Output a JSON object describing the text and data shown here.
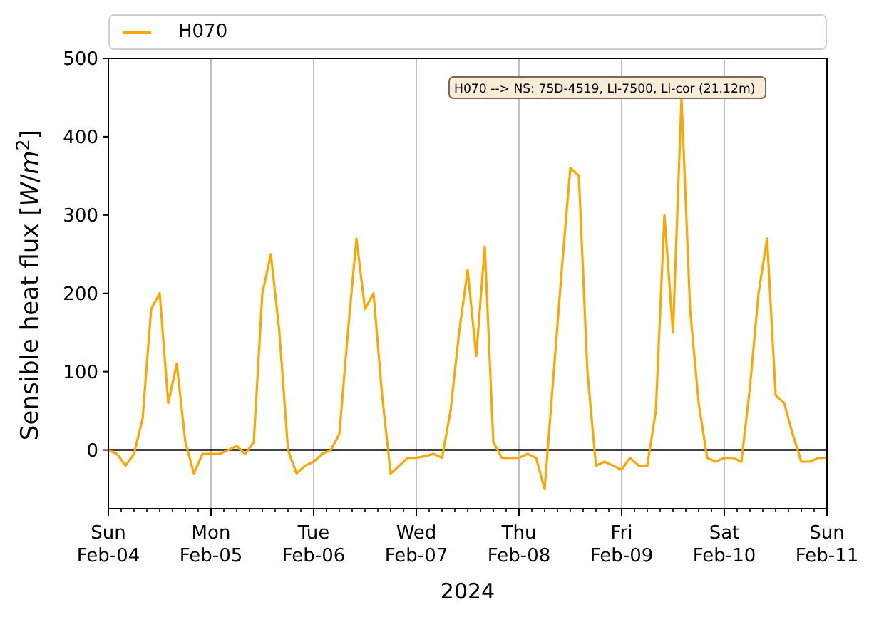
{
  "chart_data": {
    "type": "line",
    "grid": true,
    "xlabel": "2024",
    "ylabel": "Sensible heat flux [*W*/*m*$^{2}$]",
    "ylim": [
      -75,
      500
    ],
    "yticks": [
      0,
      100,
      200,
      300,
      400,
      500
    ],
    "categories": [
      "Sun\nFeb-04",
      null,
      null,
      null,
      null,
      null,
      null,
      null,
      null,
      null,
      null,
      null,
      "Mon\nFeb-05",
      null,
      null,
      null,
      null,
      null,
      null,
      null,
      null,
      null,
      null,
      null,
      "Tue\nFeb-06",
      null,
      null,
      null,
      null,
      null,
      null,
      null,
      null,
      null,
      null,
      null,
      "Wed\nFeb-07",
      null,
      null,
      null,
      null,
      null,
      null,
      null,
      null,
      null,
      null,
      null,
      "Thu\nFeb-08",
      null,
      null,
      null,
      null,
      null,
      null,
      null,
      null,
      null,
      null,
      null,
      "Fri\nFeb-09",
      null,
      null,
      null,
      null,
      null,
      null,
      null,
      null,
      null,
      null,
      null,
      "Sat\nFeb-10",
      null,
      null,
      null,
      null,
      null,
      null,
      null,
      null,
      null,
      null,
      null,
      "Sun\nFeb-11"
    ],
    "series": [
      {
        "name": "H070",
        "color": "#ffa500",
        "values": [
          0,
          -5,
          -20,
          -5,
          40,
          180,
          200,
          60,
          110,
          10,
          -30,
          -5,
          -5,
          -5,
          0,
          5,
          -5,
          10,
          200,
          250,
          150,
          0,
          -30,
          -20,
          -15,
          -5,
          0,
          20,
          150,
          270,
          180,
          200,
          70,
          -30,
          -20,
          -10,
          -10,
          -8,
          -5,
          -10,
          50,
          150,
          230,
          120,
          260,
          10,
          -10,
          -10,
          -10,
          -5,
          -10,
          -50,
          90,
          230,
          360,
          350,
          100,
          -20,
          -15,
          -20,
          -25,
          -10,
          -20,
          -20,
          50,
          300,
          150,
          450,
          180,
          60,
          -10,
          -15,
          -10,
          -10,
          -15,
          80,
          200,
          270,
          70,
          60,
          20,
          -15,
          -15,
          -10,
          -10
        ]
      }
    ],
    "annotations": [
      {
        "text": "H070 --> NS: 75D-4519, LI-7500, Li-cor (21.12m)"
      }
    ]
  }
}
